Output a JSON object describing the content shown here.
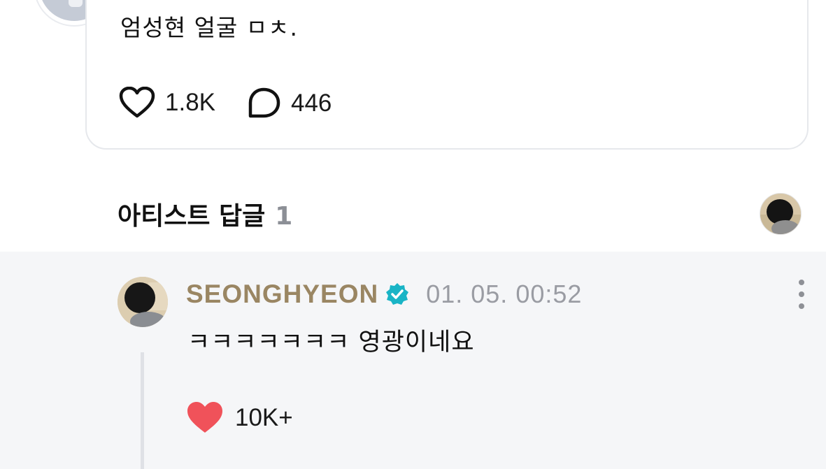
{
  "post": {
    "text": "엄성현 얼굴 ㅁㅊ.",
    "likes_count": "1.8K",
    "comments_count": "446"
  },
  "artist_replies": {
    "title": "아티스트 답글",
    "count": "1"
  },
  "reply": {
    "author": "SEONGHYEON",
    "timestamp": "01. 05. 00:52",
    "text": "ㅋㅋㅋㅋㅋㅋㅋ 영광이네요",
    "likes_count": "10K+"
  },
  "colors": {
    "artist_name": "#9a8663",
    "verified_badge": "#19b4c6",
    "liked_heart": "#f0525a",
    "panel_background": "#f5f6f8"
  },
  "icons": {
    "like": "heart-outline-icon",
    "comment": "speech-bubble-icon",
    "verified": "verified-badge-icon",
    "more": "more-vertical-icon",
    "liked": "heart-filled-icon"
  }
}
